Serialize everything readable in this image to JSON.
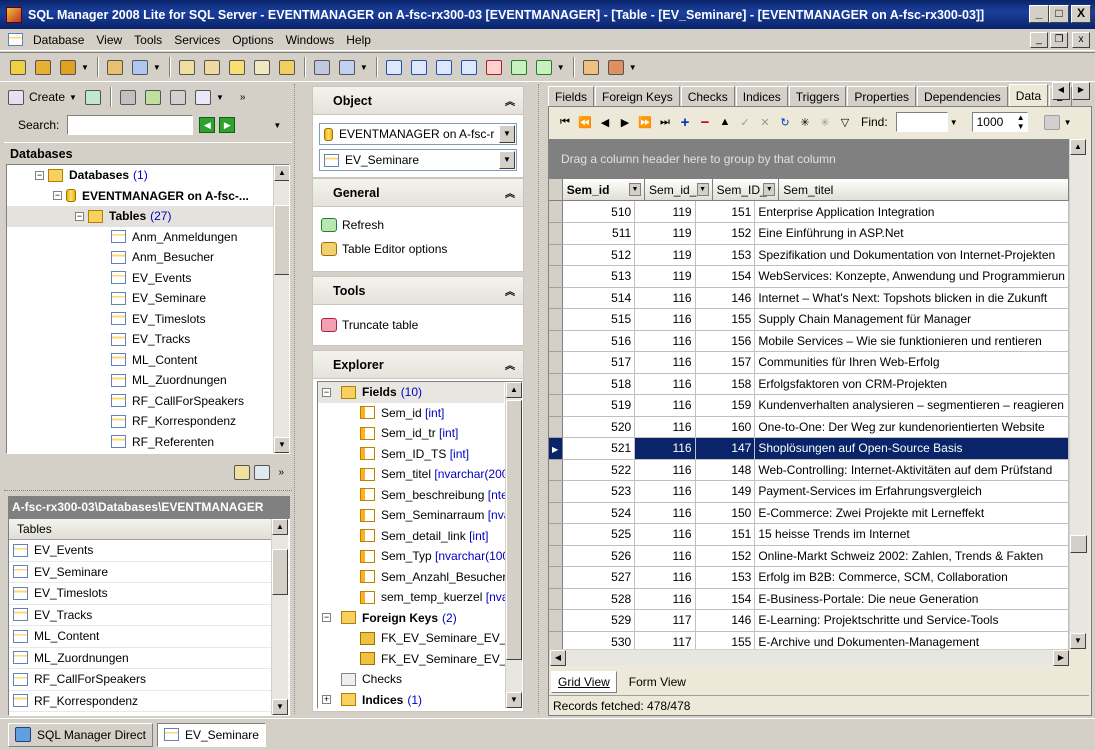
{
  "window": {
    "title": "SQL Manager 2008 Lite for SQL Server - EVENTMANAGER on A-fsc-rx300-03 [EVENTMANAGER] - [Table - [EV_Seminare] - [EVENTMANAGER on A-fsc-rx300-03]]",
    "min": "_",
    "max": "□",
    "close": "X"
  },
  "menu": [
    "Database",
    "View",
    "Tools",
    "Services",
    "Options",
    "Windows",
    "Help"
  ],
  "left": {
    "create_label": "Create",
    "search_label": "Search:",
    "search_value": "",
    "databases_header": "Databases",
    "tree": {
      "root": "Databases",
      "root_count": "(1)",
      "db": "EVENTMANAGER on A-fsc-...",
      "tables": "Tables",
      "tables_count": "(27)",
      "items": [
        "Anm_Anmeldungen",
        "Anm_Besucher",
        "EV_Events",
        "EV_Seminare",
        "EV_Timeslots",
        "EV_Tracks",
        "ML_Content",
        "ML_Zuordnungen",
        "RF_CallForSpeakers",
        "RF_Korrespondenz",
        "RF_Referenten"
      ]
    },
    "path_header": "A-fsc-rx300-03\\Databases\\EVENTMANAGER",
    "list_header": "Tables",
    "list": [
      "EV_Events",
      "EV_Seminare",
      "EV_Timeslots",
      "EV_Tracks",
      "ML_Content",
      "ML_Zuordnungen",
      "RF_CallForSpeakers",
      "RF_Korrespondenz"
    ]
  },
  "middle": {
    "object_header": "Object",
    "object_db": "EVENTMANAGER on A-fsc-r",
    "object_table": "EV_Seminare",
    "general_header": "General",
    "refresh": "Refresh",
    "table_editor_options": "Table Editor options",
    "tools_header": "Tools",
    "truncate": "Truncate table",
    "explorer_header": "Explorer",
    "fields_label": "Fields",
    "fields_count": "(10)",
    "fields": [
      {
        "name": "Sem_id",
        "type": "[int]"
      },
      {
        "name": "Sem_id_tr",
        "type": "[int]"
      },
      {
        "name": "Sem_ID_TS",
        "type": "[int]"
      },
      {
        "name": "Sem_titel",
        "type": "[nvarchar(200)"
      },
      {
        "name": "Sem_beschreibung",
        "type": "[ntex"
      },
      {
        "name": "Sem_Seminarraum",
        "type": "[nvar"
      },
      {
        "name": "Sem_detail_link",
        "type": "[int]"
      },
      {
        "name": "Sem_Typ",
        "type": "[nvarchar(100"
      },
      {
        "name": "Sem_Anzahl_Besucher_",
        "type": ""
      },
      {
        "name": "sem_temp_kuerzel",
        "type": "[nvar"
      }
    ],
    "fk_label": "Foreign Keys",
    "fk_count": "(2)",
    "fks": [
      "FK_EV_Seminare_EV_T",
      "FK_EV_Seminare_EV_T"
    ],
    "checks_label": "Checks",
    "indices_label": "Indices",
    "indices_count": "(1)"
  },
  "right": {
    "tabs": [
      "Fields",
      "Foreign Keys",
      "Checks",
      "Indices",
      "Triggers",
      "Properties",
      "Dependencies",
      "Data",
      "D"
    ],
    "active_tab": "Data",
    "find_label": "Find:",
    "find_value": "",
    "row_limit": "1000",
    "group_hint": "Drag a column header here to group by that column",
    "columns": [
      "Sem_id",
      "Sem_id_",
      "Sem_ID_",
      "Sem_titel"
    ],
    "selected_row": 11,
    "rows": [
      [
        "510",
        "119",
        "151",
        "Enterprise Application Integration"
      ],
      [
        "511",
        "119",
        "152",
        "Eine Einführung in ASP.Net"
      ],
      [
        "512",
        "119",
        "153",
        "Spezifikation und Dokumentation von Internet-Projekten"
      ],
      [
        "513",
        "119",
        "154",
        "WebServices: Konzepte, Anwendung und Programmierun"
      ],
      [
        "514",
        "116",
        "146",
        "Internet – What's Next: Topshots blicken in die Zukunft"
      ],
      [
        "515",
        "116",
        "155",
        "Supply Chain Management für Manager"
      ],
      [
        "516",
        "116",
        "156",
        "Mobile Services – Wie sie funktionieren und rentieren"
      ],
      [
        "517",
        "116",
        "157",
        "Communities für Ihren Web-Erfolg"
      ],
      [
        "518",
        "116",
        "158",
        "Erfolgsfaktoren von CRM-Projekten"
      ],
      [
        "519",
        "116",
        "159",
        "Kundenverhalten analysieren – segmentieren – reagieren"
      ],
      [
        "520",
        "116",
        "160",
        "One-to-One: Der Weg zur kundenorientierten Website"
      ],
      [
        "521",
        "116",
        "147",
        "Shoplösungen auf Open-Source Basis"
      ],
      [
        "522",
        "116",
        "148",
        "Web-Controlling: Internet-Aktivitäten auf dem Prüfstand"
      ],
      [
        "523",
        "116",
        "149",
        "Payment-Services im Erfahrungsvergleich"
      ],
      [
        "524",
        "116",
        "150",
        "E-Commerce: Zwei Projekte mit Lerneffekt"
      ],
      [
        "525",
        "116",
        "151",
        "15 heisse Trends im Internet"
      ],
      [
        "526",
        "116",
        "152",
        "Online-Markt Schweiz 2002: Zahlen, Trends & Fakten"
      ],
      [
        "527",
        "116",
        "153",
        "Erfolg im B2B: Commerce, SCM, Collaboration"
      ],
      [
        "528",
        "116",
        "154",
        "E-Business-Portale: Die neue Generation"
      ],
      [
        "529",
        "117",
        "146",
        "E-Learning: Projektschritte und Service-Tools"
      ],
      [
        "530",
        "117",
        "155",
        "E-Archive und Dokumenten-Management"
      ]
    ],
    "grid_view": "Grid View",
    "form_view": "Form View",
    "records": "Records fetched: 478/478"
  },
  "taskbar": {
    "direct": "SQL Manager Direct",
    "seminare": "EV_Seminare"
  }
}
